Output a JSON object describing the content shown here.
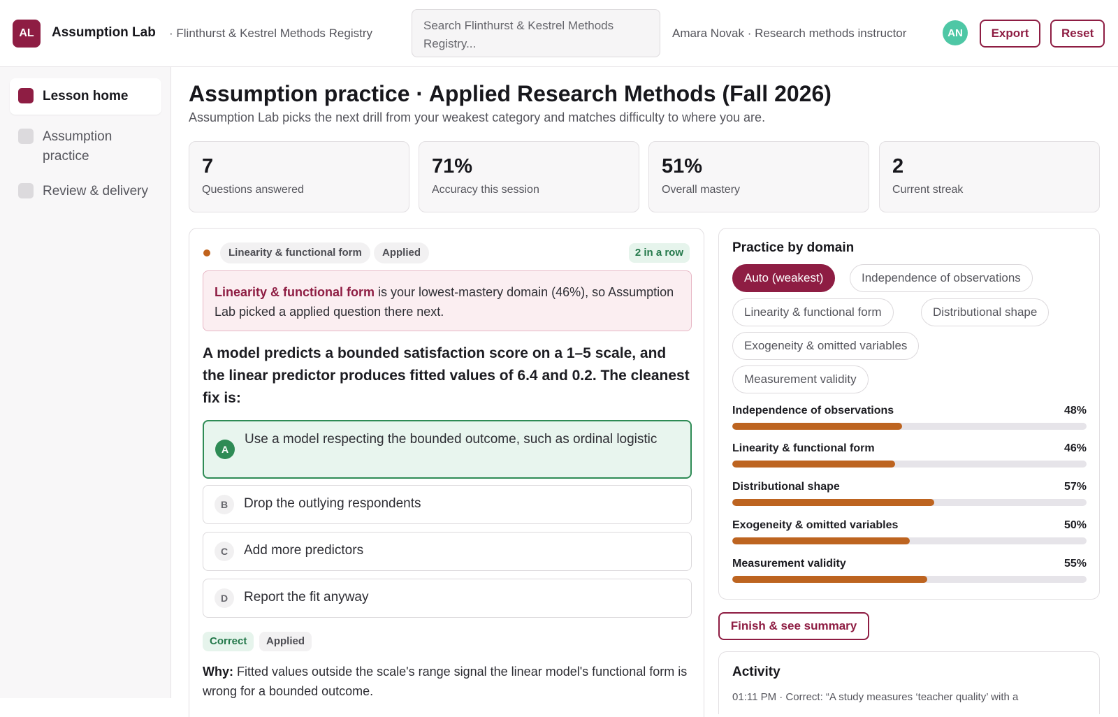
{
  "header": {
    "logo_initials": "AL",
    "app_title": "Assumption Lab",
    "registry": "· Flinthurst & Kestrel Methods Registry",
    "search_placeholder": "Search Flinthurst & Kestrel Methods Registry...",
    "user": "Amara Novak · Research methods instructor",
    "avatar_initials": "AN",
    "export_label": "Export",
    "reset_label": "Reset"
  },
  "sidebar": {
    "items": [
      {
        "label": "Lesson home",
        "active": true
      },
      {
        "label": "Assumption practice",
        "active": false
      },
      {
        "label": "Review & delivery",
        "active": false
      }
    ]
  },
  "page": {
    "title": "Assumption practice · Applied Research Methods (Fall 2026)",
    "subtitle": "Assumption Lab picks the next drill from your weakest category and matches difficulty to where you are."
  },
  "stats": [
    {
      "value": "7",
      "label": "Questions answered"
    },
    {
      "value": "71%",
      "label": "Accuracy this session"
    },
    {
      "value": "51%",
      "label": "Overall mastery"
    },
    {
      "value": "2",
      "label": "Current streak"
    }
  ],
  "question": {
    "category_tag": "Linearity & functional form",
    "level_tag": "Applied",
    "streak": "2 in a row",
    "reason_domain": "Linearity & functional form",
    "reason_rest": " is your lowest-mastery domain (46%), so Assumption Lab picked a applied question there next.",
    "text": "A model predicts a bounded satisfaction score on a 1–5 scale, and the linear predictor produces fitted values of 6.4 and 0.2. The cleanest fix is:",
    "options": [
      {
        "letter": "A",
        "text": "Use a model respecting the bounded outcome, such as ordinal logistic",
        "correct": true
      },
      {
        "letter": "B",
        "text": "Drop the outlying respondents",
        "correct": false
      },
      {
        "letter": "C",
        "text": "Add more predictors",
        "correct": false
      },
      {
        "letter": "D",
        "text": "Report the fit anyway",
        "correct": false
      }
    ],
    "result_tag": "Correct",
    "result_level": "Applied",
    "why_label": "Why:",
    "why_text": " Fitted values outside the scale's range signal the linear model's functional form is wrong for a bounded outcome."
  },
  "domains": {
    "title": "Practice by domain",
    "chips": [
      {
        "label": "Auto (weakest)",
        "active": true
      },
      {
        "label": "Independence of observations",
        "active": false
      },
      {
        "label": "Linearity & functional form",
        "active": false
      },
      {
        "label": "Distributional shape",
        "active": false
      },
      {
        "label": "Exogeneity & omitted variables",
        "active": false
      },
      {
        "label": "Measurement validity",
        "active": false
      }
    ],
    "bars": [
      {
        "name": "Independence of observations",
        "pct_label": "48%",
        "value": 48
      },
      {
        "name": "Linearity & functional form",
        "pct_label": "46%",
        "value": 46
      },
      {
        "name": "Distributional shape",
        "pct_label": "57%",
        "value": 57
      },
      {
        "name": "Exogeneity & omitted variables",
        "pct_label": "50%",
        "value": 50
      },
      {
        "name": "Measurement validity",
        "pct_label": "55%",
        "value": 55
      }
    ]
  },
  "finish_label": "Finish & see summary",
  "activity": {
    "title": "Activity",
    "line": "01:11 PM · Correct: “A study measures ‘teacher quality’ with a"
  },
  "colors": {
    "brand": "#8e1d43",
    "correct": "#2e8b55",
    "bar_fill": "#bd6420",
    "avatar": "#4ec7a5"
  }
}
